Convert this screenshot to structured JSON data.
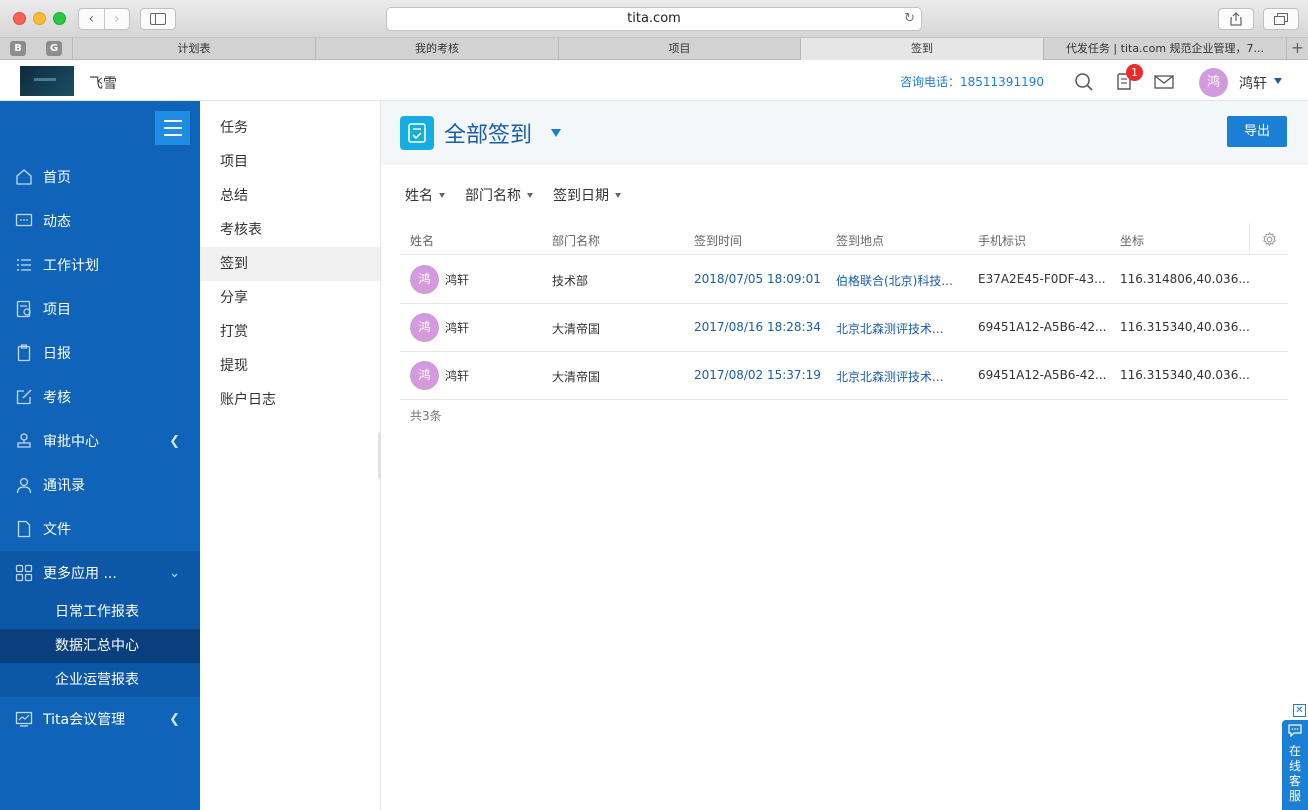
{
  "browser": {
    "url": "tita.com",
    "pinned": [
      "B",
      "G"
    ],
    "tabs": [
      "计划表",
      "我的考核",
      "项目",
      "签到",
      "代发任务 | tita.com 规范企业管理，7..."
    ]
  },
  "header": {
    "company": "飞雪",
    "hotline": "咨询电话：18511391190",
    "notification_count": "1",
    "user_avatar": "鸿",
    "user_name": "鸿轩"
  },
  "leftnav": {
    "items": [
      {
        "label": "首页",
        "icon": "home-icon"
      },
      {
        "label": "动态",
        "icon": "chat-icon"
      },
      {
        "label": "工作计划",
        "icon": "list-icon"
      },
      {
        "label": "项目",
        "icon": "project-icon"
      },
      {
        "label": "日报",
        "icon": "report-icon"
      },
      {
        "label": "考核",
        "icon": "edit-icon"
      },
      {
        "label": "审批中心",
        "icon": "stamp-icon"
      },
      {
        "label": "通讯录",
        "icon": "contact-icon"
      },
      {
        "label": "文件",
        "icon": "file-icon"
      },
      {
        "label": "更多应用 ...",
        "icon": "apps-icon"
      }
    ],
    "sub_items": [
      "日常工作报表",
      "数据汇总中心",
      "企业运营报表"
    ],
    "meeting": "Tita会议管理"
  },
  "submenu": [
    "任务",
    "项目",
    "总结",
    "考核表",
    "签到",
    "分享",
    "打赏",
    "提现",
    "账户日志"
  ],
  "main": {
    "title": "全部签到",
    "export": "导出",
    "filters": [
      "姓名",
      "部门名称",
      "签到日期"
    ],
    "columns": [
      "姓名",
      "部门名称",
      "签到时间",
      "签到地点",
      "手机标识",
      "坐标"
    ],
    "rows": [
      {
        "avatar": "鸿",
        "name": "鸿轩",
        "dept": "技术部",
        "time": "2018/07/05 18:09:01",
        "place": "伯格联合(北京)科技...",
        "device": "E37A2E45-F0DF-43...",
        "coord": "116.314806,40.036..."
      },
      {
        "avatar": "鸿",
        "name": "鸿轩",
        "dept": "大清帝国",
        "time": "2017/08/16 18:28:34",
        "place": "北京北森测评技术...",
        "device": "69451A12-A5B6-42...",
        "coord": "116.315340,40.036..."
      },
      {
        "avatar": "鸿",
        "name": "鸿轩",
        "dept": "大清帝国",
        "time": "2017/08/02 15:37:19",
        "place": "北京北森测评技术...",
        "device": "69451A12-A5B6-42...",
        "coord": "116.315340,40.036..."
      }
    ],
    "total": "共3条"
  },
  "chat": {
    "label": "在线客服",
    "close": "✕"
  },
  "colors": {
    "nav_bg": "#0f63b9",
    "accent": "#1c7fd6",
    "link": "#1a5ea8",
    "avatar": "#d39ade",
    "badge": "#ee2b2b"
  }
}
